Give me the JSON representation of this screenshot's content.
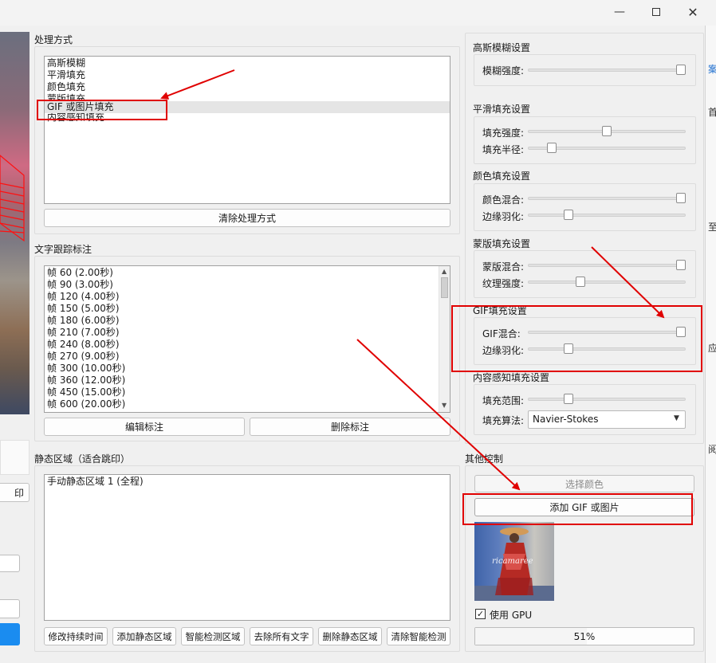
{
  "sections": {
    "process_method": "处理方式",
    "text_tracking": "文字跟踪标注",
    "static_region": "静态区域（适合跳印）",
    "gaussian": "高斯模糊设置",
    "smooth": "平滑填充设置",
    "color": "颜色填充设置",
    "mask": "蒙版填充设置",
    "gif": "GIF填充设置",
    "content_aware": "内容感知填充设置",
    "other": "其他控制"
  },
  "process_methods": [
    "高斯模糊",
    "平滑填充",
    "颜色填充",
    "蒙版填充",
    "GIF 或图片填充",
    "内容感知填充"
  ],
  "selected_method": "GIF 或图片填充",
  "buttons": {
    "clear_methods": "清除处理方式",
    "edit_mark": "编辑标注",
    "delete_mark": "删除标注",
    "modify_duration": "修改持续时间",
    "add_static": "添加静态区域",
    "smart_detect": "智能检测区域",
    "remove_all_text": "去除所有文字",
    "delete_static": "删除静态区域",
    "clear_smart": "清除智能检测",
    "select_color": "选择颜色",
    "add_gif": "添加 GIF 或图片"
  },
  "frames": [
    "帧 60 (2.00秒)",
    "帧 90 (3.00秒)",
    "帧 120 (4.00秒)",
    "帧 150 (5.00秒)",
    "帧 180 (6.00秒)",
    "帧 210 (7.00秒)",
    "帧 240 (8.00秒)",
    "帧 270 (9.00秒)",
    "帧 300 (10.00秒)",
    "帧 360 (12.00秒)",
    "帧 450 (15.00秒)",
    "帧 600 (20.00秒)"
  ],
  "static_regions": [
    "手动静态区域 1 (全程)"
  ],
  "sliders": {
    "blur_strength": {
      "label": "模糊强度:",
      "value": 1.0
    },
    "fill_strength": {
      "label": "填充强度:",
      "value": 0.5
    },
    "fill_radius": {
      "label": "填充半径:",
      "value": 0.13
    },
    "color_mix": {
      "label": "颜色混合:",
      "value": 1.0
    },
    "edge_feather_color": {
      "label": "边缘羽化:",
      "value": 0.24
    },
    "mask_mix": {
      "label": "蒙版混合:",
      "value": 1.0
    },
    "texture_strength": {
      "label": "纹理强度:",
      "value": 0.32
    },
    "gif_mix": {
      "label": "GIF混合:",
      "value": 1.0
    },
    "edge_feather_gif": {
      "label": "边缘羽化:",
      "value": 0.24
    },
    "fill_range": {
      "label": "填充范围:",
      "value": 0.24
    }
  },
  "fill_algorithm": {
    "label": "填充算法:",
    "value": "Navier-Stokes"
  },
  "use_gpu": {
    "label": "使用 GPU",
    "checked": true
  },
  "progress": {
    "text": "51%",
    "value": 51
  },
  "left_partial": {
    "print_button": "印"
  },
  "edge_glyphs": [
    "案",
    "首",
    "至",
    "应",
    "阅"
  ],
  "thumbnail_caption": "ricamaree",
  "colors": {
    "highlight": "#e00000",
    "window_bg": "#f0f0f0"
  }
}
